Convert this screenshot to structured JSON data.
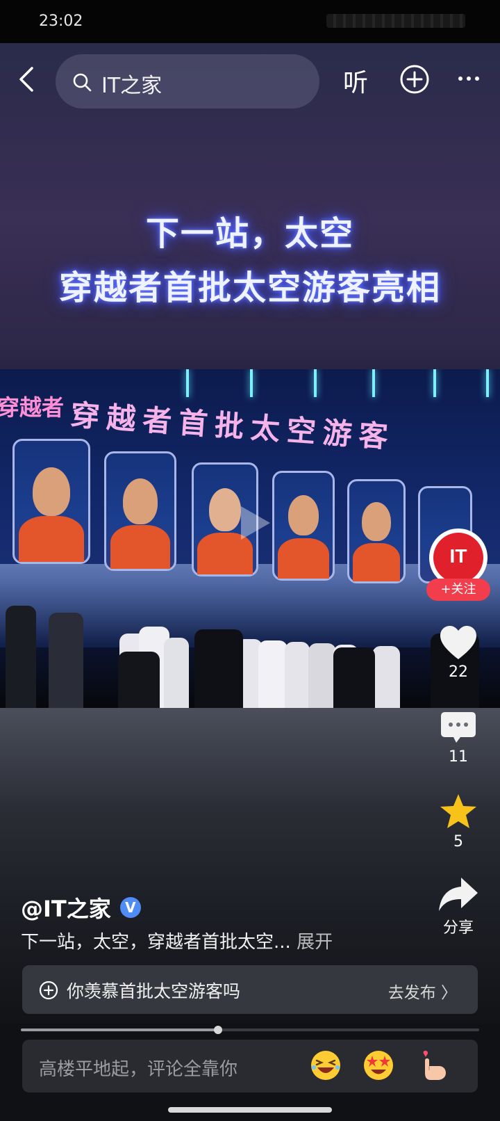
{
  "status_bar": {
    "time": "23:02"
  },
  "top_bar": {
    "search_text": "IT之家",
    "listen_label": "听"
  },
  "video": {
    "headline_line1": "下一站，太空",
    "headline_line2": "穿越者首批太空游客亮相",
    "photo_logo": "穿越者",
    "photo_title": "穿越者首批太空游客"
  },
  "rail": {
    "avatar_text": "IT",
    "follow_label": "+关注",
    "like_count": "22",
    "comment_count": "11",
    "favorite_count": "5",
    "share_label": "分享"
  },
  "post": {
    "author": "@IT之家",
    "verified_mark": "V",
    "description": "下一站，太空，穿越者首批太空...",
    "expand_label": "展开"
  },
  "topic": {
    "text": "你羡慕首批太空游客吗",
    "action": "去发布 〉"
  },
  "progress": {
    "value": 0.43
  },
  "comment": {
    "placeholder": "高楼平地起，评论全靠你"
  },
  "colors": {
    "follow_red": "#f23d4d",
    "favorite_yellow": "#f7c21a",
    "verified_blue": "#4f8cf5"
  }
}
